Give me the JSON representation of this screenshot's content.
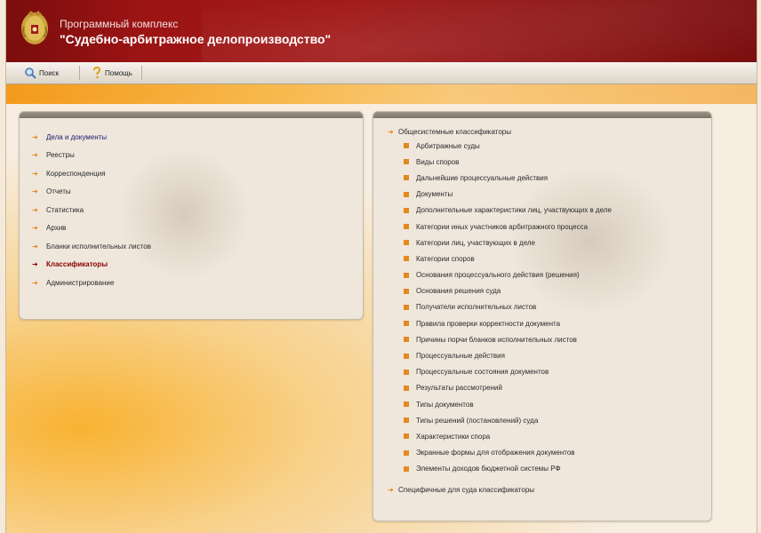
{
  "header": {
    "subtitle": "Программный комплекс",
    "title": "\"Судебно-арбитражное делопроизводство\""
  },
  "toolbar": {
    "search_label": "Поиск",
    "help_label": "Помощь"
  },
  "nav": {
    "items": [
      {
        "label": "Дела и документы"
      },
      {
        "label": "Реестры"
      },
      {
        "label": "Корреспонденция"
      },
      {
        "label": "Отчеты"
      },
      {
        "label": "Статистика"
      },
      {
        "label": "Архив"
      },
      {
        "label": "Бланки исполнительных листов"
      },
      {
        "label": "Классификаторы"
      },
      {
        "label": "Администрирование"
      }
    ]
  },
  "tree": {
    "root_label": "Общесистемные классификаторы",
    "children": [
      {
        "label": "Арбитражные суды"
      },
      {
        "label": "Виды споров"
      },
      {
        "label": "Дальнейшие процессуальные действия"
      },
      {
        "label": "Документы"
      },
      {
        "label": "Дополнительные характеристики лиц, участвующих в деле"
      },
      {
        "label": "Категории иных участников арбитражного процесса"
      },
      {
        "label": "Категории лиц, участвующих в деле"
      },
      {
        "label": "Категории споров"
      },
      {
        "label": "Основания процессуального действия (решения)"
      },
      {
        "label": "Основания решения суда"
      },
      {
        "label": "Получатели исполнительных листов"
      },
      {
        "label": "Правила проверки корректности документа"
      },
      {
        "label": "Причины порчи бланков исполнительных листов"
      },
      {
        "label": "Процессуальные действия"
      },
      {
        "label": "Процессуальные состояния документов"
      },
      {
        "label": "Результаты рассмотрений"
      },
      {
        "label": "Типы документов"
      },
      {
        "label": "Типы решений (постановлений) суда"
      },
      {
        "label": "Характеристики спора"
      },
      {
        "label": "Экранные формы для отображения документов"
      },
      {
        "label": "Элементы доходов бюджетной системы РФ"
      }
    ],
    "second_root_label": "Специфичные для суда классификаторы"
  },
  "colors": {
    "header_red": "#9c1414",
    "accent_orange": "#e8821a",
    "active_item": "#8b0000"
  }
}
